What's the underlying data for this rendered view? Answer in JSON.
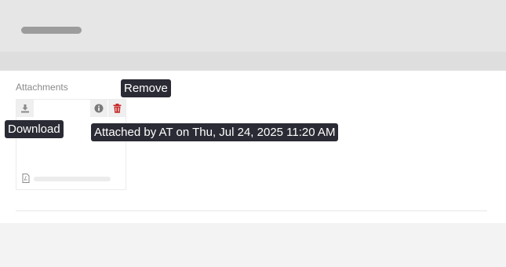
{
  "attachments": {
    "label": "Attachments"
  },
  "tooltips": {
    "remove": "Remove",
    "download": "Download",
    "info": "Attached by AT on Thu, Jul 24, 2025 11:20 AM"
  },
  "colors": {
    "remove_icon": "#c62828",
    "tooltip_bg": "#2b2b35"
  },
  "icons": [
    "download-icon",
    "info-icon",
    "trash-icon",
    "pdf-file-icon"
  ]
}
